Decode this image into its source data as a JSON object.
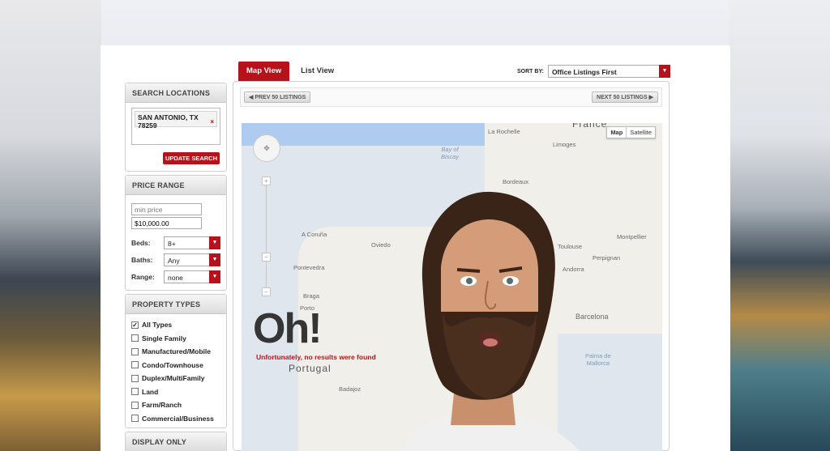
{
  "tabs": {
    "map_view": "Map View",
    "list_view": "List View"
  },
  "sort": {
    "label": "SORT BY:",
    "value": "Office Listings First"
  },
  "sidebar": {
    "search_locations": {
      "title": "SEARCH LOCATIONS",
      "chip": "SAN ANTONIO, TX 78259",
      "remove": "×",
      "button": "UPDATE SEARCH"
    },
    "price_range": {
      "title": "PRICE RANGE",
      "min_placeholder": "min price",
      "max_value": "$10,000.00",
      "beds_label": "Beds:",
      "beds_value": "8+",
      "baths_label": "Baths:",
      "baths_value": "Any",
      "range_label": "Range:",
      "range_value": "none"
    },
    "property_types": {
      "title": "PROPERTY TYPES",
      "items": [
        {
          "label": "All Types",
          "checked": true
        },
        {
          "label": "Single Family",
          "checked": false
        },
        {
          "label": "Manufactured/Mobile",
          "checked": false
        },
        {
          "label": "Condo/Townhouse",
          "checked": false
        },
        {
          "label": "Duplex/MultiFamily",
          "checked": false
        },
        {
          "label": "Land",
          "checked": false
        },
        {
          "label": "Farm/Ranch",
          "checked": false
        },
        {
          "label": "Commercial/Business",
          "checked": false
        }
      ]
    },
    "display_only": {
      "title": "DISPLAY ONLY"
    }
  },
  "pager": {
    "prev": "PREV 50 LISTINGS",
    "next": "NEXT 50 LISTINGS",
    "prev_icon": "triangle-left-icon",
    "next_icon": "triangle-right-icon"
  },
  "map": {
    "type_map": "Map",
    "type_satellite": "Satellite",
    "labels": {
      "france": "France",
      "la_rochelle": "La Rochelle",
      "limoges": "Limoges",
      "bay_of_biscay": "Bay of\nBiscay",
      "bordeaux": "Bordeaux",
      "toulouse": "Toulouse",
      "montpellier": "Montpellier",
      "perpignan": "Perpignan",
      "andorra": "Andorra",
      "a_coruna": "A Coruña",
      "oviedo": "Oviedo",
      "pontevedra": "Pontevedra",
      "braga": "Braga",
      "porto": "Porto",
      "portugal": "Portugal",
      "badajoz": "Badajoz",
      "barcelona": "Barcelona",
      "palma": "Palma de\nMallorca"
    }
  },
  "message": {
    "headline": "Oh!",
    "subtitle": "Unfortunately, no results were found"
  },
  "colors": {
    "accent": "#b5121b",
    "sea": "#dfe6ee",
    "land": "#f1efe9"
  }
}
